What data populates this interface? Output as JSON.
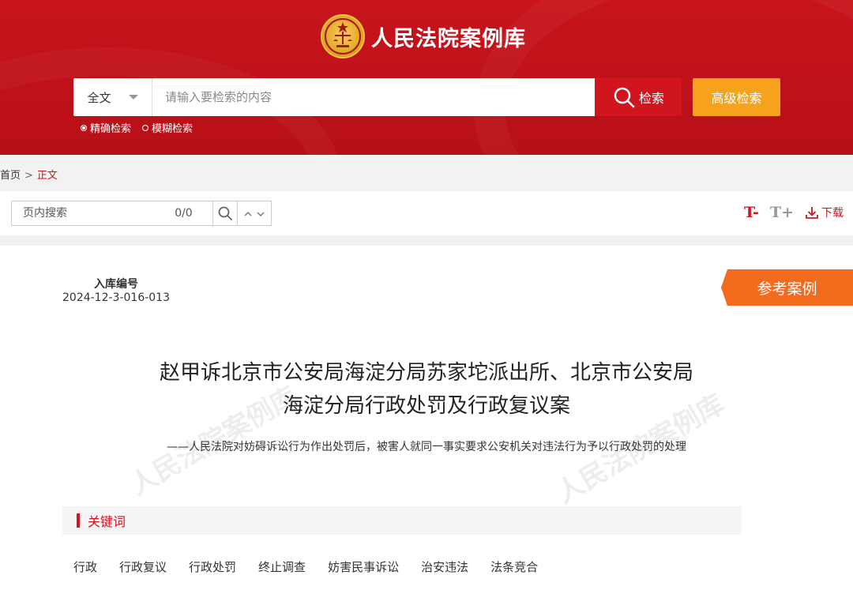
{
  "site": {
    "title": "人民法院案例库"
  },
  "search": {
    "scope": "全文",
    "placeholder": "请输入要检索的内容",
    "search_label": "检索",
    "advanced_label": "高级检索",
    "modes": [
      {
        "label": "精确检索",
        "selected": true
      },
      {
        "label": "模糊检索",
        "selected": false
      }
    ]
  },
  "breadcrumb": {
    "home": "首页",
    "separator": ">",
    "current": "正文"
  },
  "toolbar": {
    "find_placeholder": "页内搜索",
    "find_count": "0/0",
    "font_decrease": "T-",
    "font_increase": "T+",
    "download_label": "下载"
  },
  "case": {
    "id_label": "入库编号",
    "id_value": "2024-12-3-016-013",
    "badge": "参考案例",
    "title_line1": "赵甲诉北京市公安局海淀分局苏家坨派出所、北京市公安局",
    "title_line2": "海淀分局行政处罚及行政复议案",
    "subtitle": "——人民法院对妨碍诉讼行为作出处罚后，被害人就同一事实要求公安机关对违法行为予以行政处罚的处理",
    "watermark": "人民法院案例库"
  },
  "keywords": {
    "title": "关键词",
    "items": [
      "行政",
      "行政复议",
      "行政处罚",
      "终止调查",
      "妨害民事诉讼",
      "治安违法",
      "法条竞合"
    ]
  },
  "colors": {
    "brand_red": "#c8141c",
    "accent_orange": "#f7a21c",
    "badge_orange": "#f36b1c"
  }
}
